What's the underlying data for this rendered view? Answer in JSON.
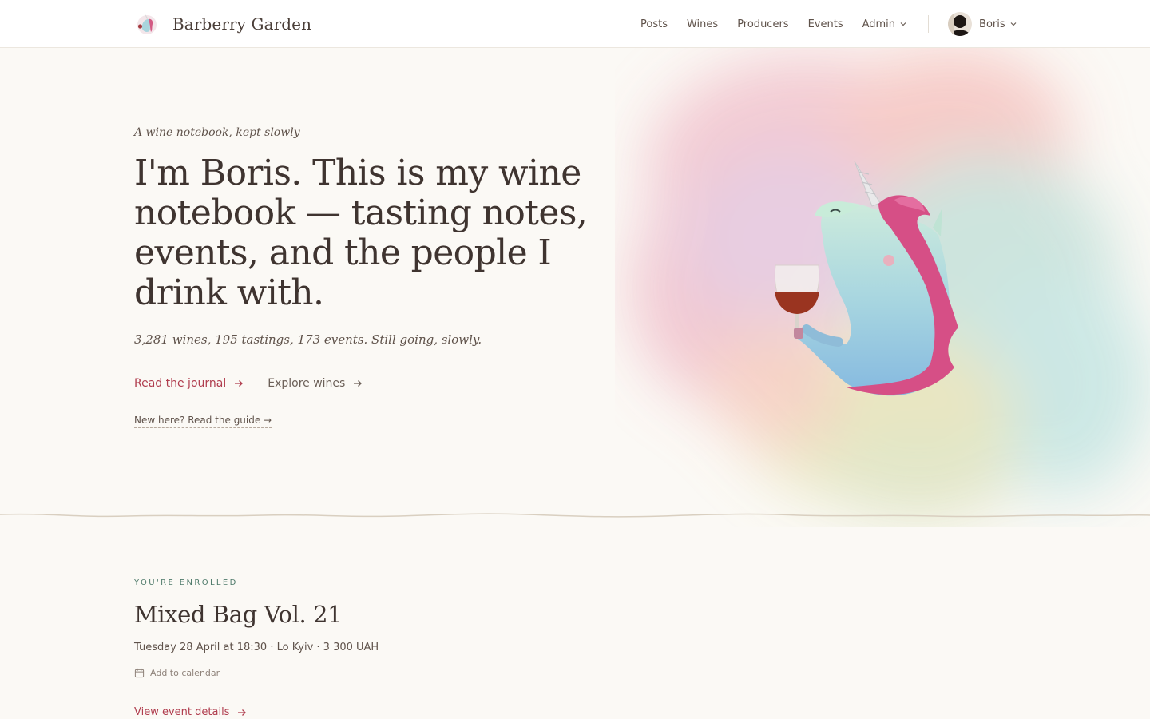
{
  "header": {
    "brand": "Barberry Garden",
    "nav": [
      "Posts",
      "Wines",
      "Producers",
      "Events",
      "Admin"
    ],
    "user": "Boris"
  },
  "hero": {
    "eyebrow": "A wine notebook, kept slowly",
    "headline": "I'm Boris. This is my wine notebook — tasting notes, events, and the people I drink with.",
    "stats": "3,281 wines, 195 tastings, 173 events. Still going, slowly.",
    "cta_primary": "Read the journal",
    "cta_secondary": "Explore wines",
    "guide_link": "New here? Read the guide →"
  },
  "enrolled": {
    "label": "YOU'RE ENROLLED",
    "title": "Mixed Bag Vol. 21",
    "meta": "Tuesday 28 April at 18:30 · Lo Kyiv · 3 300 UAH",
    "add_calendar": "Add to calendar",
    "details_link": "View event details"
  },
  "colors": {
    "accent": "#b03d4e",
    "eyebrow_green": "#4e7a6a",
    "text": "#3f3430",
    "background": "#fbf9f5"
  },
  "icons": {
    "logo": "unicorn-logo-icon",
    "chevron": "chevron-down-icon",
    "arrow": "arrow-right-icon",
    "calendar": "calendar-icon",
    "hero": "unicorn-wine-illustration"
  }
}
